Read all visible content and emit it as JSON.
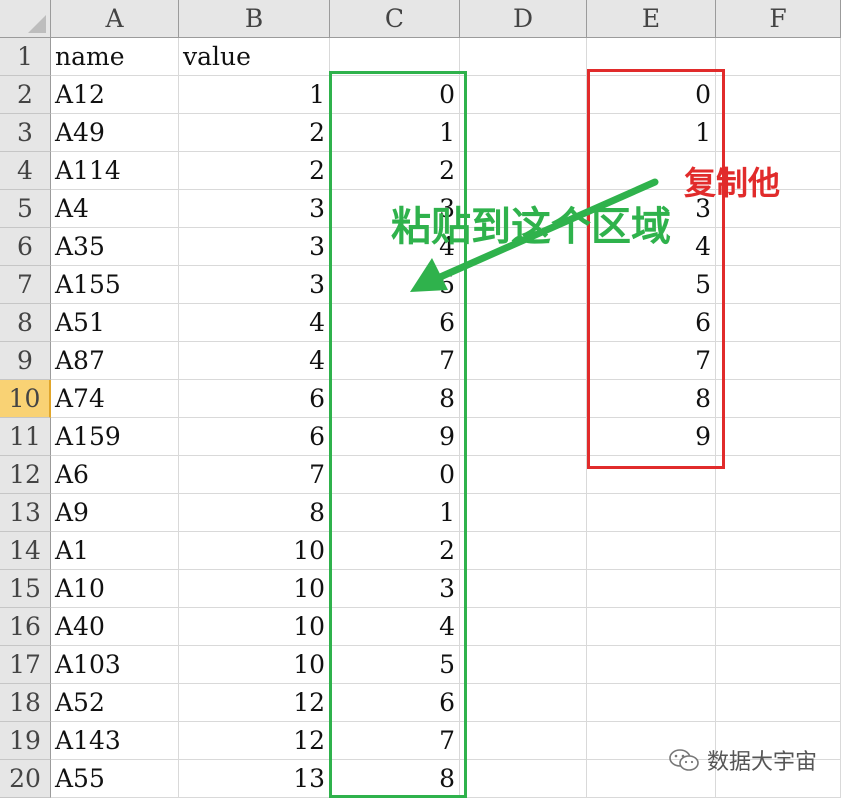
{
  "columns": [
    "A",
    "B",
    "C",
    "D",
    "E",
    "F"
  ],
  "rows": [
    {
      "n": "1",
      "a": "name",
      "b": "value",
      "c": "",
      "e": ""
    },
    {
      "n": "2",
      "a": "A12",
      "b": "1",
      "c": "0",
      "e": "0"
    },
    {
      "n": "3",
      "a": "A49",
      "b": "2",
      "c": "1",
      "e": "1"
    },
    {
      "n": "4",
      "a": "A114",
      "b": "2",
      "c": "2",
      "e": ""
    },
    {
      "n": "5",
      "a": "A4",
      "b": "3",
      "c": "3",
      "e": "3"
    },
    {
      "n": "6",
      "a": "A35",
      "b": "3",
      "c": "4",
      "e": "4"
    },
    {
      "n": "7",
      "a": "A155",
      "b": "3",
      "c": "5",
      "e": "5"
    },
    {
      "n": "8",
      "a": "A51",
      "b": "4",
      "c": "6",
      "e": "6"
    },
    {
      "n": "9",
      "a": "A87",
      "b": "4",
      "c": "7",
      "e": "7"
    },
    {
      "n": "10",
      "a": "A74",
      "b": "6",
      "c": "8",
      "e": "8"
    },
    {
      "n": "11",
      "a": "A159",
      "b": "6",
      "c": "9",
      "e": "9"
    },
    {
      "n": "12",
      "a": "A6",
      "b": "7",
      "c": "0",
      "e": ""
    },
    {
      "n": "13",
      "a": "A9",
      "b": "8",
      "c": "1",
      "e": ""
    },
    {
      "n": "14",
      "a": "A1",
      "b": "10",
      "c": "2",
      "e": ""
    },
    {
      "n": "15",
      "a": "A10",
      "b": "10",
      "c": "3",
      "e": ""
    },
    {
      "n": "16",
      "a": "A40",
      "b": "10",
      "c": "4",
      "e": ""
    },
    {
      "n": "17",
      "a": "A103",
      "b": "10",
      "c": "5",
      "e": ""
    },
    {
      "n": "18",
      "a": "A52",
      "b": "12",
      "c": "6",
      "e": ""
    },
    {
      "n": "19",
      "a": "A143",
      "b": "12",
      "c": "7",
      "e": ""
    },
    {
      "n": "20",
      "a": "A55",
      "b": "13",
      "c": "8",
      "e": ""
    }
  ],
  "active_row": "10",
  "annotations": {
    "paste_label": "粘贴到这个区域",
    "copy_label": "复制他"
  },
  "watermark": {
    "text": "数据大宇宙",
    "icon": "wechat-icon"
  },
  "colors": {
    "paste_box": "#2fb24c",
    "copy_box": "#e12b2b",
    "active_row_header": "#f9d274"
  }
}
